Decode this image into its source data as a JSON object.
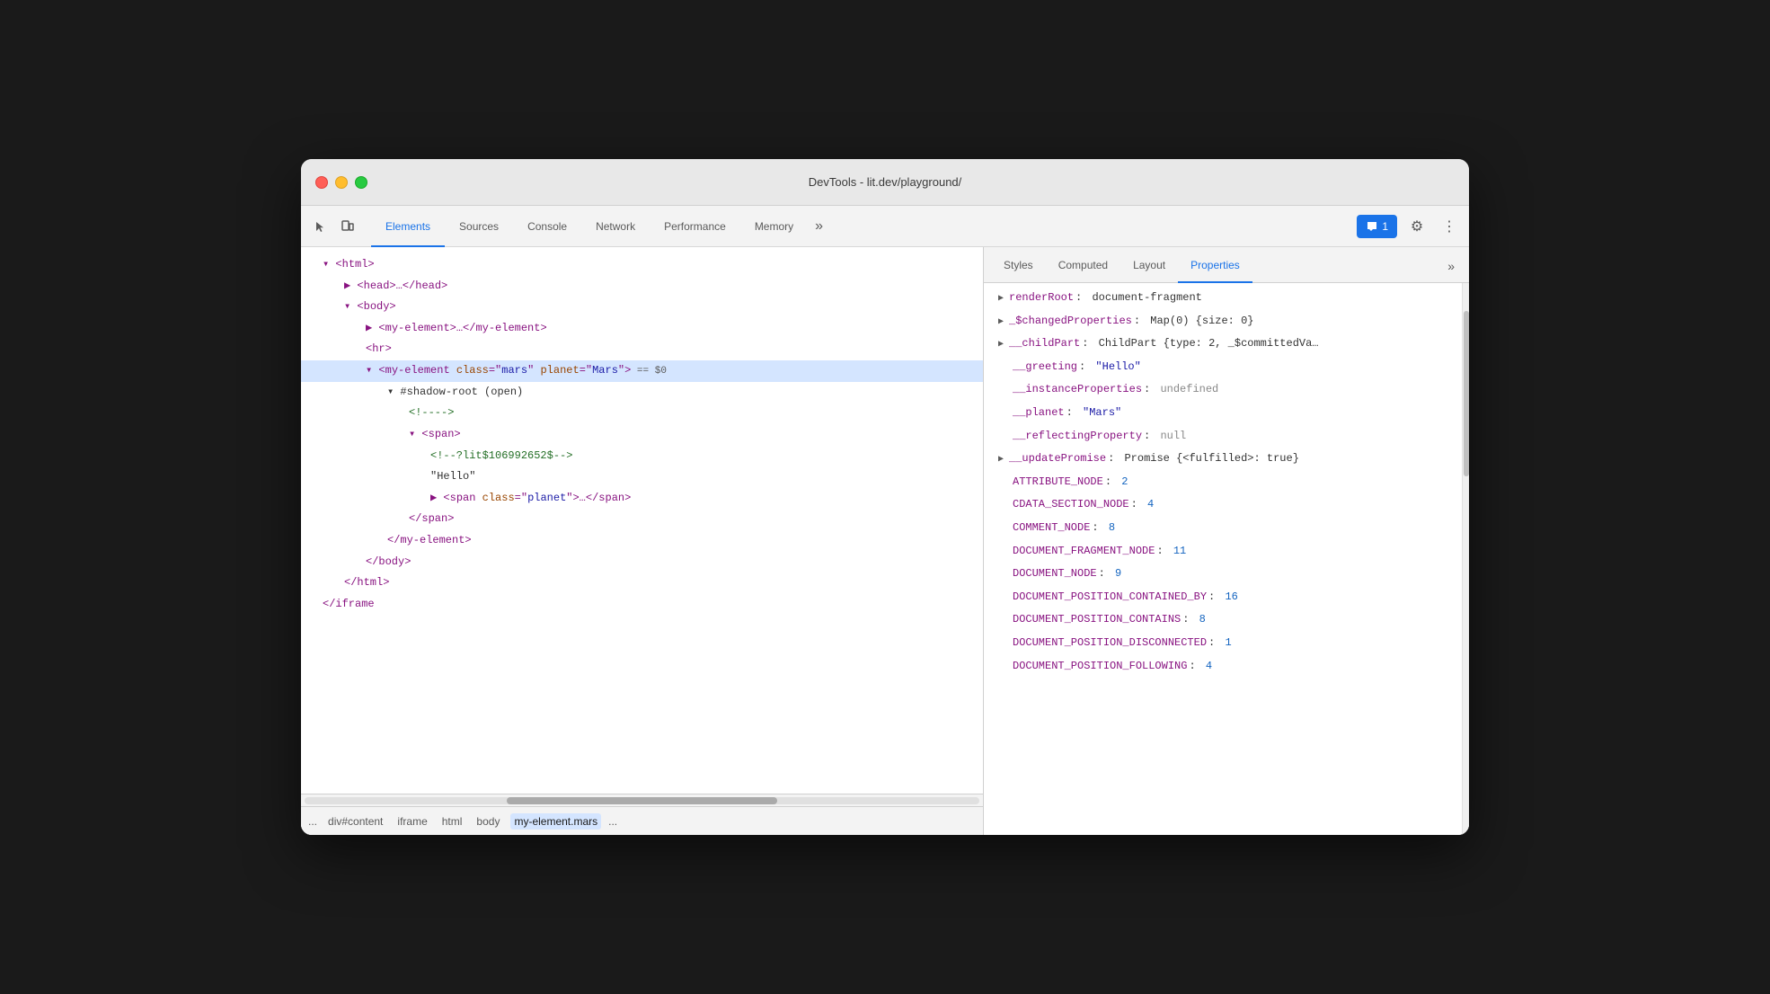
{
  "window": {
    "title": "DevTools - lit.dev/playground/"
  },
  "toolbar": {
    "tabs": [
      {
        "label": "Elements",
        "active": true
      },
      {
        "label": "Sources",
        "active": false
      },
      {
        "label": "Console",
        "active": false
      },
      {
        "label": "Network",
        "active": false
      },
      {
        "label": "Performance",
        "active": false
      },
      {
        "label": "Memory",
        "active": false
      }
    ],
    "more_label": "»",
    "feedback_label": "1",
    "settings_icon": "⚙",
    "more_icon": "⋮"
  },
  "right_panel": {
    "tabs": [
      {
        "label": "Styles",
        "active": false
      },
      {
        "label": "Computed",
        "active": false
      },
      {
        "label": "Layout",
        "active": false
      },
      {
        "label": "Properties",
        "active": true
      }
    ],
    "more_label": "»"
  },
  "dom": {
    "lines": [
      {
        "indent": 1,
        "content": "▾ <html>",
        "type": "tag"
      },
      {
        "indent": 2,
        "content": "▶ <head>…</head>",
        "type": "tag"
      },
      {
        "indent": 2,
        "content": "▾ <body>",
        "type": "tag"
      },
      {
        "indent": 3,
        "content": "▶ <my-element>…</my-element>",
        "type": "tag"
      },
      {
        "indent": 3,
        "content": "<hr>",
        "type": "tag"
      },
      {
        "indent": 3,
        "content": "▾ <my-element class=\"mars\" planet=\"Mars\"> == $0",
        "type": "selected"
      },
      {
        "indent": 4,
        "content": "▾ #shadow-root (open)",
        "type": "shadow"
      },
      {
        "indent": 5,
        "content": "<!---->",
        "type": "comment"
      },
      {
        "indent": 5,
        "content": "▾ <span>",
        "type": "tag"
      },
      {
        "indent": 6,
        "content": "<!--?lit$106992652$-->",
        "type": "comment"
      },
      {
        "indent": 6,
        "content": "\"Hello\"",
        "type": "string"
      },
      {
        "indent": 6,
        "content": "▶ <span class=\"planet\">…</span>",
        "type": "tag"
      },
      {
        "indent": 5,
        "content": "</span>",
        "type": "tag"
      },
      {
        "indent": 4,
        "content": "</my-element>",
        "type": "tag"
      },
      {
        "indent": 3,
        "content": "</body>",
        "type": "tag"
      },
      {
        "indent": 2,
        "content": "</html>",
        "type": "tag"
      },
      {
        "indent": 1,
        "content": "</iframe>",
        "type": "tag"
      }
    ]
  },
  "breadcrumbs": [
    {
      "label": "...",
      "active": false
    },
    {
      "label": "div#content",
      "active": false
    },
    {
      "label": "iframe",
      "active": false
    },
    {
      "label": "html",
      "active": false
    },
    {
      "label": "body",
      "active": false
    },
    {
      "label": "my-element.mars",
      "active": true
    },
    {
      "label": "...",
      "active": false
    }
  ],
  "properties": [
    {
      "key": "renderRoot",
      "colon": ":",
      "value": "document-fragment",
      "type": "obj",
      "expandable": true
    },
    {
      "key": "_$changedProperties",
      "colon": ":",
      "value": "Map(0) {size: 0}",
      "type": "obj",
      "expandable": true
    },
    {
      "key": "__childPart",
      "colon": ":",
      "value": "ChildPart {type: 2, _$committedVa…",
      "type": "obj",
      "expandable": true
    },
    {
      "key": "__greeting",
      "colon": ":",
      "value": "\"Hello\"",
      "type": "string",
      "expandable": false
    },
    {
      "key": "__instanceProperties",
      "colon": ":",
      "value": "undefined",
      "type": "undefined",
      "expandable": false
    },
    {
      "key": "__planet",
      "colon": ":",
      "value": "\"Mars\"",
      "type": "string",
      "expandable": false
    },
    {
      "key": "__reflectingProperty",
      "colon": ":",
      "value": "null",
      "type": "null",
      "expandable": false
    },
    {
      "key": "__updatePromise",
      "colon": ":",
      "value": "Promise {<fulfilled>: true}",
      "type": "obj",
      "expandable": true
    },
    {
      "key": "ATTRIBUTE_NODE",
      "colon": ":",
      "value": "2",
      "type": "number",
      "expandable": false
    },
    {
      "key": "CDATA_SECTION_NODE",
      "colon": ":",
      "value": "4",
      "type": "number",
      "expandable": false
    },
    {
      "key": "COMMENT_NODE",
      "colon": ":",
      "value": "8",
      "type": "number",
      "expandable": false
    },
    {
      "key": "DOCUMENT_FRAGMENT_NODE",
      "colon": ":",
      "value": "11",
      "type": "number",
      "expandable": false
    },
    {
      "key": "DOCUMENT_NODE",
      "colon": ":",
      "value": "9",
      "type": "number",
      "expandable": false
    },
    {
      "key": "DOCUMENT_POSITION_CONTAINED_BY",
      "colon": ":",
      "value": "16",
      "type": "number",
      "expandable": false
    },
    {
      "key": "DOCUMENT_POSITION_CONTAINS",
      "colon": ":",
      "value": "8",
      "type": "number",
      "expandable": false
    },
    {
      "key": "DOCUMENT_POSITION_DISCONNECTED",
      "colon": ":",
      "value": "1",
      "type": "number",
      "expandable": false
    },
    {
      "key": "DOCUMENT_POSITION_FOLLOWING",
      "colon": ":",
      "value": "4",
      "type": "number",
      "expandable": false
    }
  ]
}
